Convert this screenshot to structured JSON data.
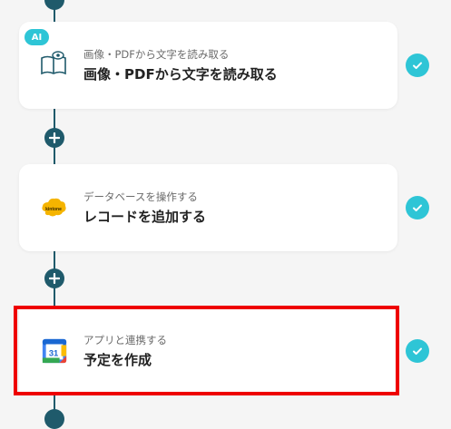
{
  "steps": [
    {
      "badge": "AI",
      "subtitle": "画像・PDFから文字を読み取る",
      "title": "画像・PDFから文字を読み取る",
      "icon": "ocr-book-eye-icon",
      "status": "completed"
    },
    {
      "subtitle": "データベースを操作する",
      "title": "レコードを追加する",
      "icon": "kintone-icon",
      "icon_text": "kintone",
      "status": "completed"
    },
    {
      "subtitle": "アプリと連携する",
      "title": "予定を作成",
      "icon": "google-calendar-icon",
      "icon_text": "31",
      "status": "completed",
      "selected": true
    }
  ],
  "colors": {
    "accent": "#2ec5d6",
    "connector": "#1f5a6b",
    "highlight": "#ee0000",
    "kintone": "#f5b400"
  }
}
